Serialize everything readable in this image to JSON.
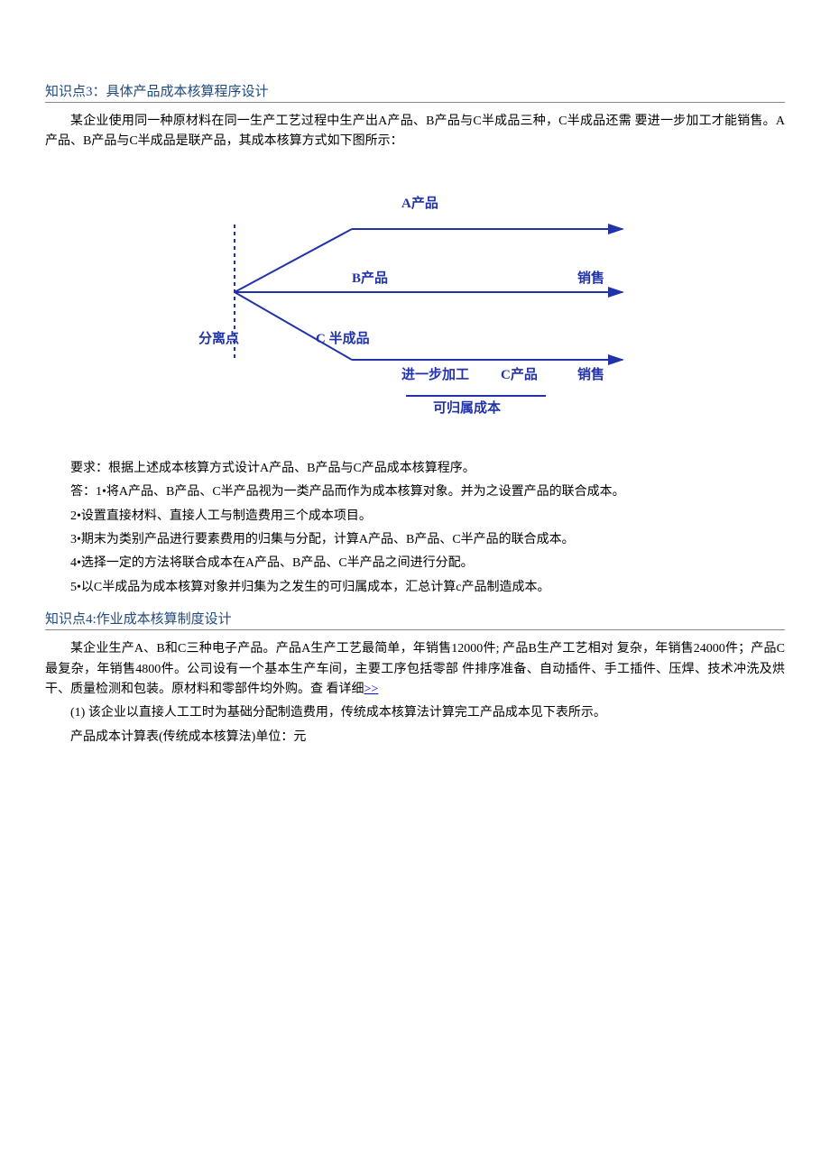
{
  "section3": {
    "title": "知识点3：具体产品成本核算程序设计",
    "intro": "某企业使用同一种原材料在同一生产工艺过程中生产出A产品、B产品与C半成品三种，C半成品还需  要进一步加工才能销售。A产品、B产品与C半成品是联产品，其成本核算方式如下图所示：",
    "diagram": {
      "a": "A产品",
      "b": "B产品",
      "c": "C 半成品",
      "split": "分离点",
      "further": "进一步加工",
      "cprod": "C产品",
      "sale": "销售",
      "attr": "可归属成本"
    },
    "req": "要求：根据上述成本核算方式设计A产品、B产品与C产品成本核算程序。",
    "ans1": "答：1•将A产品、B产品、C半产品视为一类产品而作为成本核算对象。并为之设置产品的联合成本。",
    "ans2": "2•设置直接材料、直接人工与制造费用三个成本项目。",
    "ans3": "3•期末为类别产品进行要素费用的归集与分配，计算A产品、B产品、C半产品的联合成本。",
    "ans4": "4•选择一定的方法将联合成本在A产品、B产品、C半产品之间进行分配。",
    "ans5": "5•以C半成品为成本核算对象并归集为之发生的可归属成本，汇总计算c产品制造成本。"
  },
  "section4": {
    "title": "知识点4:作业成本核算制度设计",
    "p1_a": "某企业生产A、B和C三种电子产品。产品A生产工艺最简单，年销售12000件; 产品B生产工艺相对 复杂，年销售24000件；产品C最复杂，年销售4800件。公司设有一个基本生产车间，主要工序包括零部   件排序准备、自动插件、手工插件、压焊、技术冲洗及烘干、质量检测和包装。原材料和零部件均外购。查 看详细",
    "more": ">>",
    "p2": "(1)   该企业以直接人工工时为基础分配制造费用，传统成本核算法计算完工产品成本见下表所示。",
    "p3": "产品成本计算表(传统成本核算法)单位：元"
  }
}
